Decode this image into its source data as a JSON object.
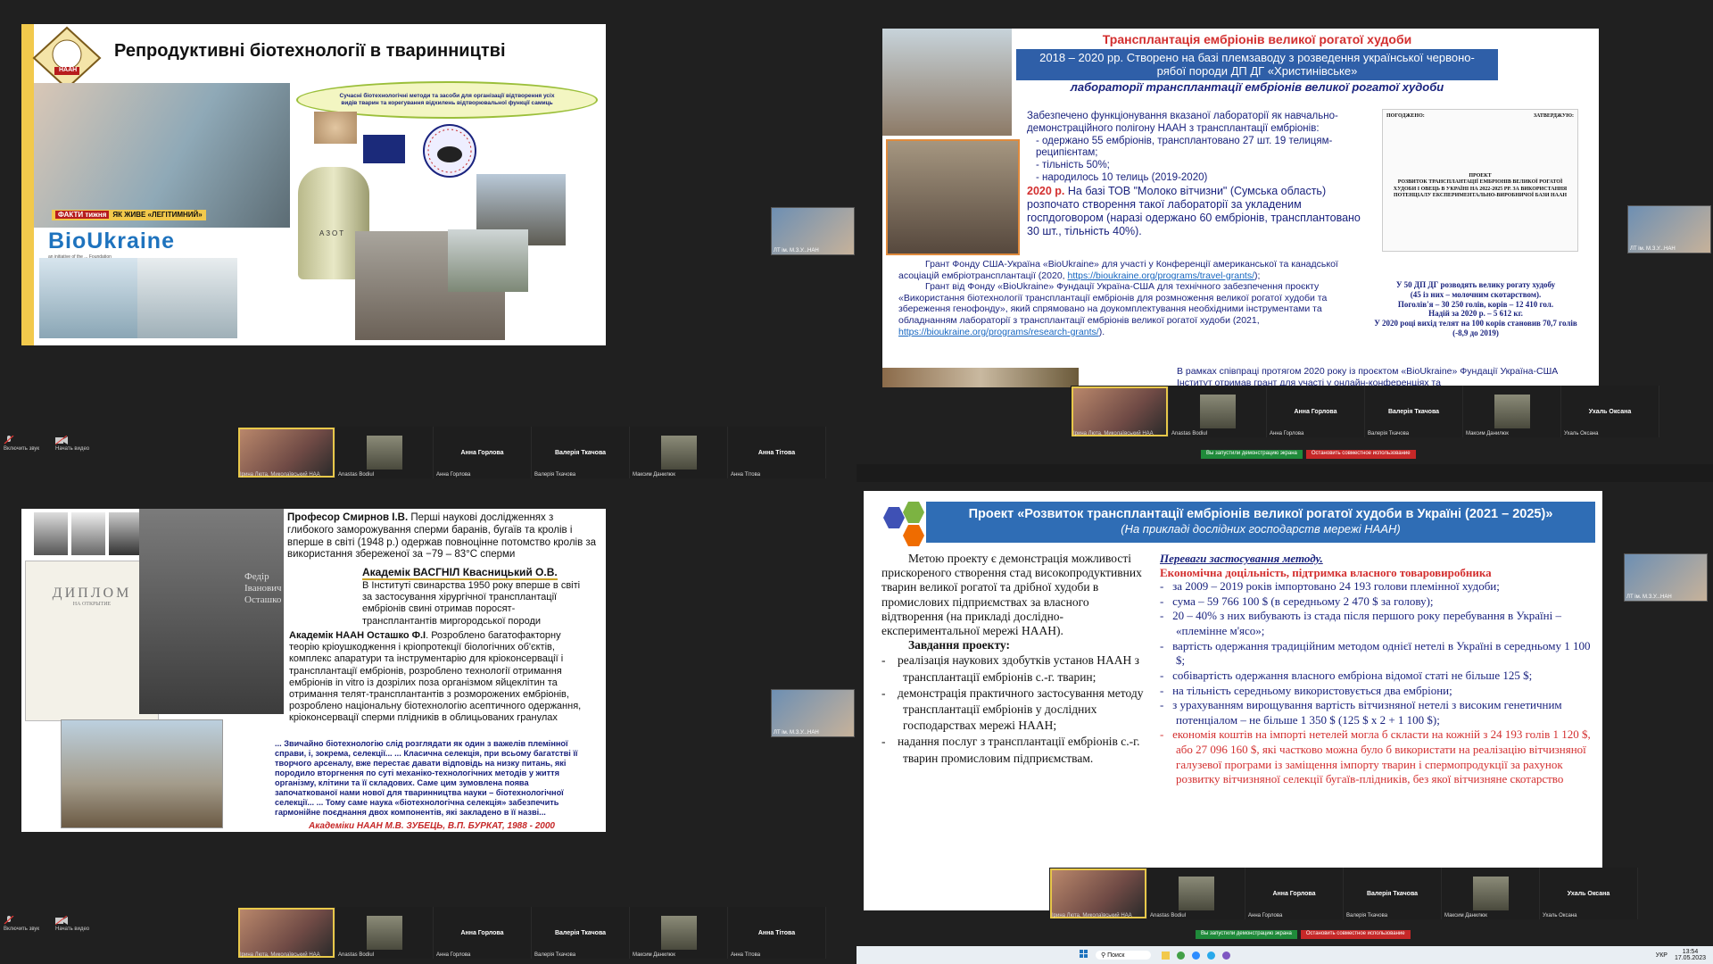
{
  "participants": {
    "speaker": "Ірина Люта, Миколаївський НАА",
    "tiles": [
      {
        "label": "",
        "name": "Anastas Bodiul"
      },
      {
        "label": "Анна Горлова",
        "name": "Анна Горлова"
      },
      {
        "label": "Валерія Ткачова",
        "name": "Валерія Ткачова"
      },
      {
        "label": "",
        "name": "Максим Данилюк"
      },
      {
        "label": "Анна Тітова",
        "name": "Анна Тітова"
      }
    ],
    "tiles_right": [
      {
        "label": "",
        "name": "Anastas Bodiul"
      },
      {
        "label": "Анна Горлова",
        "name": "Анна Горлова"
      },
      {
        "label": "Валерія Ткачова",
        "name": "Валерія Ткачова"
      },
      {
        "label": "",
        "name": "Максим Данилюк"
      },
      {
        "label": "Ухаль Оксана",
        "name": "Ухаль Оксана"
      }
    ],
    "self_name": "ЛТ ім. М.З.У...НАН",
    "self_name_2": "ЛТ ім. М.З.У...НАН"
  },
  "controls": {
    "mic": "Включить звук",
    "video": "Начать видео"
  },
  "sharebar": {
    "running": "Вы запустили демонстрацию экрана",
    "stop": "Остановить совместное использование"
  },
  "slide1": {
    "title": "Репродуктивні біотехнології в тваринництві",
    "logo": "НААН",
    "oval": "Сучасні біотехнологічні методи та засоби для організації відтворення усіх видів тварин та корегування відхилень відтворювальної функції самиць",
    "bioukraine": "BioUkraine",
    "bioukraine_sub": "an initiative of the ... Foundation",
    "tank_label": "АЗОТ",
    "caption": "ЯК ЖИВЕ «ЛЕГІТИМНИЙ»",
    "caption_brand": "ФАКТИ тижня"
  },
  "slide2": {
    "title": "Трансплантація ембріонів великої рогатої худоби",
    "subtitle": "2018 – 2020 рр. Створено на базі племзаводу з розведення української червоно-рябої породи ДП ДГ «Христинівське»",
    "subtitle2": "лабораторії трансплантації ембріонів великої рогатої худоби",
    "intro": "Забезпечено функціонування вказаної лабораторії як навчально-демонстраційного полігону НААН з трансплантації ембріонів:",
    "bullets": [
      "одержано 55 ембріонів, трансплантовано 27 шт. 19 телицям-реципієнтам;",
      "тільність 50%;",
      "народилось 10 телиць (2019-2020)"
    ],
    "y2020_bold": "2020 р.",
    "y2020_text": " На базі ТОВ \"Молоко вітчизни\" (Сумська область) розпочато створення такої лабораторії за укладеним госпдоговором (наразі одержано 60 ембріонів, трансплантовано 30 шт., тільність 40%).",
    "grant1": "Грант Фонду США-Україна «BioUkraine» для участі у Конференції американської та канадської асоціацій ембріотрансплантації (2020, ",
    "grant1_link": "https://bioukraine.org/programs/travel-grants/",
    "grant1_end": ");",
    "grant2": "Грант від Фонду «BioUkraine» Фундації Україна-США для технічного забезпечення проєкту «Використання біотехнології трансплантації ембріонів для розмноження великої рогатої худоби та збереження генофонду», який спрямовано на доукомплектування необхідними інструментами та обладнанням лабораторії з трансплантації ембріонів великої рогатої худоби (2021, ",
    "grant2_link": "https://bioukraine.org/programs/research-grants/",
    "grant2_end": ").",
    "bottom": "В рамках співпраці протягом 2020 року із проєктом «BioUkraine» Фундації Україна-США Інститут отримав грант для участі у онлайн-конференціях та",
    "doc_left": "ПОГОДЖЕНО:",
    "doc_right": "ЗАТВЕРДЖУЮ:",
    "doc_project": "ПРОЕКТ",
    "doc_title": "РОЗВИТОК ТРАНСПЛАНТАЦІЇ ЕМБРІОНІВ ВЕЛИКОЇ РОГАТОЇ ХУДОБИ І ОВЕЦЬ В УКРАЇНІ НА 2022-2025 РР. ЗА ВИКОРИСТАННЯ ПОТЕНЦІАЛУ ЕКСПЕРИМЕНТАЛЬНО-ВИРОБНИЧОЇ БАЗИ НААН",
    "stats": [
      "У 50 ДП ДГ розводять велику рогату худобу",
      "(45 із них – молочним скотарством).",
      "Поголів'я – 30 250 голів, корів – 12 410 гол.",
      "Надій за 2020 р. – 5 612 кг.",
      "У 2020 році вихід телят на 100 корів становив 70,7 голів",
      "(-8,9 до 2019)"
    ]
  },
  "slide3": {
    "smirnov_bold": "Професор Смирнов І.В.",
    "smirnov": " Перші наукові дослідженнях з глибокого заморожування сперми баранів, бугаїв та кролів і вперше в світі (1948 р.) одержав повноцінне потомство кролів за використання збереженої за −79 – 83°С сперми",
    "kvas_title": "Академік ВАСГНІЛ Квасницький О.В.",
    "kvas": "В Інституті свинарства 1950 року вперше в світі за застосування хірургічної трансплантації ембріонів свині отримав поросят-трансплантантів миргородської породи",
    "ost_bold": "Академік НААН Осташко Ф.І",
    "ost": ". Розроблено багатофакторну теорію кріоушкодження і кріопротекції біологічних об'єктів, комплекс апаратури та інструментарію для кріоконсервації і трансплантації ембріонів, розроблено технології отримання ембріонів in vitro із дозрілих поза організмом яйцеклітин та отримання телят-трансплантантів з розморожених ембріонів, розроблено національну біотехнологію асептичного одержання, кріоконсервації сперми плідників в облицьованих гранулах",
    "quote": "... Звичайно біотехнологію слід розглядати як один з важелів племінної справи, і, зокрема, селекції... ... Класична селекція, при всьому багатстві її творчого арсеналу, вже перестає давати відповідь на низку питань, які породило вторгнення по суті механіко-технологічних методів у життя організму, клітини та її складових. Саме цим зумовлена поява започаткованої нами нової для тваринництва науки – біотехнологічної селекції... ... Тому саме наука «біотехнологічна селекція» забезпечить гармонійне поєднання двох компонентів, які закладено в її назві...",
    "quote_author": "Академіки НААН М.В. ЗУБЕЦЬ, В.П. БУРКАТ, 1988 - 2000",
    "diploma": "ДИПЛОМ",
    "diploma_sub": "НА ОТКРЫТИЕ",
    "plaque_name": "Федір Іванович Осташко"
  },
  "slide4": {
    "title": "Проект «Розвиток трансплантації ембріонів великої рогатої худоби в Україні (2021 – 2025)»",
    "subtitle": "(На прикладі дослідних господарств мережі НААН)",
    "goal": "Метою проекту є демонстрація можливості прискореного створення стад високопродуктивних тварин великої рогатої та дрібної худоби в промислових підприємствах за власного відтворення (на прикладі дослідно-експериментальної мережі НААН).",
    "tasks_title": "Завдання проекту:",
    "tasks": [
      "реалізація наукових здобутків установ НААН з трансплантації ембріонів с.-г. тварин;",
      "демонстрація практичного застосування методу трансплантації ембріонів у дослідних господарствах мережі НААН;",
      "надання послуг з трансплантації ембріонів с.-г. тварин промисловим підприємствам."
    ],
    "adv_title": "Переваги застосування методу.",
    "adv_sub": "Економічна доцільність, підтримка власного товаровиробника",
    "adv": [
      {
        "t": "за 2009 – 2019 років імпортовано 24 193 голови племінної худоби;",
        "c": "navy"
      },
      {
        "t": "сума – 59 766 100 $ (в середньому 2 470 $ за голову);",
        "c": "navy"
      },
      {
        "t": "20 – 40% з них вибувають із стада після першого року перебування в Україні – «племінне м'ясо»;",
        "c": "navy"
      },
      {
        "t": "вартість одержання традиційним методом однієї нетелі в Україні в середньому 1 100 $;",
        "c": "navy"
      },
      {
        "t": "собівартість одержання власного ембріона відомої статі не більше 125 $;",
        "c": "navy"
      },
      {
        "t": "на тільність середньому використовується два ембріони;",
        "c": "navy"
      },
      {
        "t": "з урахуванням вирощування вартість вітчизняної нетелі з високим генетичним потенціалом – не більше 1 350 $ (125 $ х 2 + 1 100 $);",
        "c": "navy"
      },
      {
        "t": "економія коштів на імпорті нетелей могла б скласти на кожній з 24 193 голів 1 120 $, або 27 096 160 $, які частково можна було б використати на реалізацію вітчизняної галузевої програми із заміщення імпорту тварин і спермопродукції за рахунок розвитку вітчизняної селекції бугаїв-плідників, без якої вітчизняне скотарство",
        "c": "red"
      }
    ]
  },
  "taskbar": {
    "search": "Поиск",
    "lang": "УКР",
    "time": "13:54",
    "date": "17.05.2023"
  },
  "colors": {
    "navy": "#1a237e",
    "red": "#d32f2f",
    "blue_band": "#2f5fa8",
    "slide_blue": "#1565c0"
  }
}
